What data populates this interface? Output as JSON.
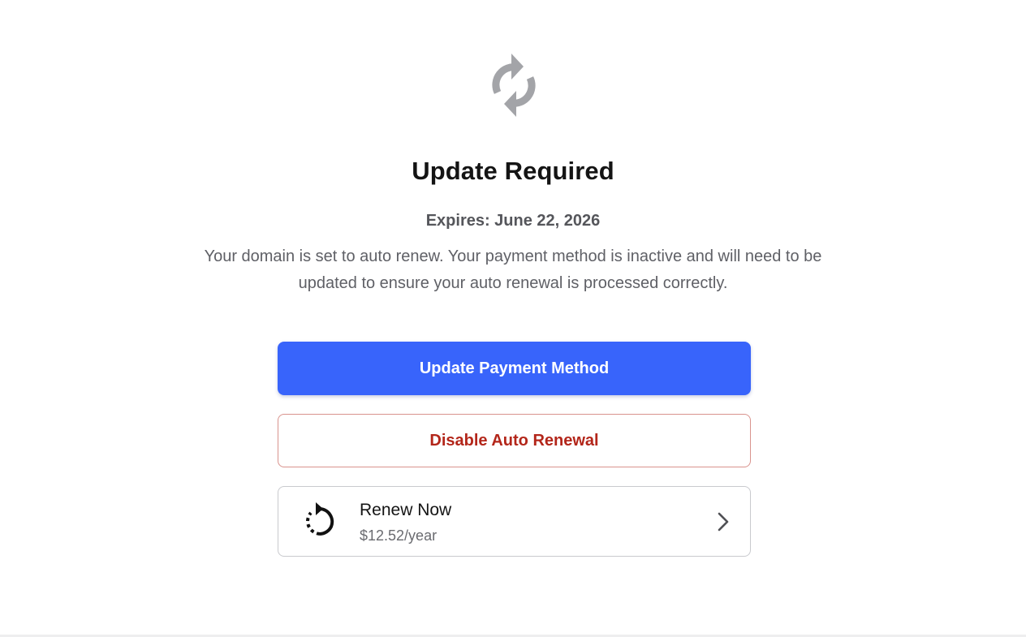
{
  "hero": {
    "icon": "refresh-icon",
    "icon_color": "#a3a4a8"
  },
  "title": "Update Required",
  "expires": "Expires: June 22, 2026",
  "description": "Your domain is set to auto renew. Your payment method is inactive and will need to be updated to ensure your auto renewal is processed correctly.",
  "actions": {
    "update_payment_label": "Update Payment Method",
    "disable_auto_renewal_label": "Disable Auto Renewal"
  },
  "renew": {
    "icon": "renew-clock-icon",
    "title": "Renew Now",
    "price": "$12.52/year",
    "chevron": "chevron-right-icon"
  },
  "colors": {
    "primary": "#3864fb",
    "danger_text": "#b3261a",
    "danger_border": "#d9938d"
  }
}
